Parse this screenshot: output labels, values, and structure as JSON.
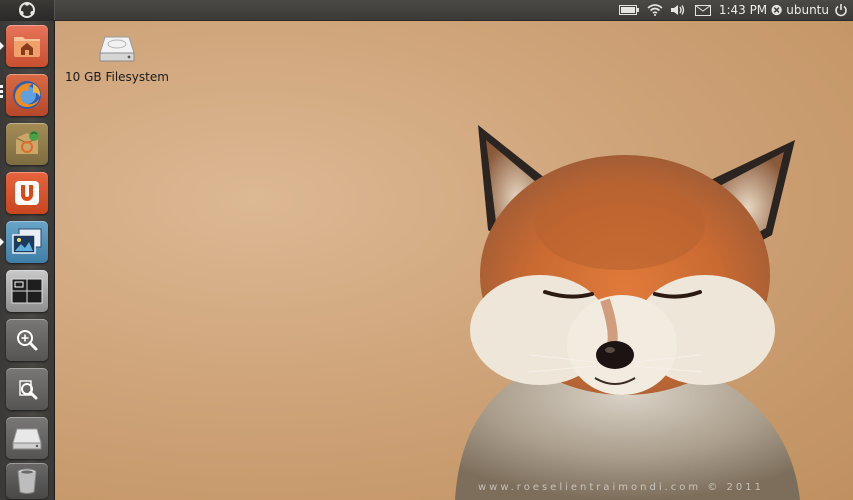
{
  "top_panel": {
    "clock": "1:43 PM",
    "username": "ubuntu",
    "indicators": {
      "battery_icon": "battery-icon",
      "network_icon": "wifi-icon",
      "sound_icon": "volume-icon",
      "messaging_icon": "mail-icon",
      "power_icon": "power-icon"
    }
  },
  "launcher": {
    "items": [
      {
        "name": "home-folder",
        "icon": "folder-home-icon"
      },
      {
        "name": "firefox",
        "icon": "firefox-icon"
      },
      {
        "name": "ubuntu-software-center",
        "icon": "software-center-icon"
      },
      {
        "name": "ubuntu-one",
        "icon": "ubuntu-one-icon",
        "glyph": "U"
      },
      {
        "name": "shotwell",
        "icon": "photo-viewer-icon"
      },
      {
        "name": "workspace-switcher",
        "icon": "workspace-switcher-icon"
      },
      {
        "name": "dash-applications",
        "icon": "zoom-in-icon"
      },
      {
        "name": "dash-files",
        "icon": "file-search-icon"
      },
      {
        "name": "filesystem",
        "icon": "drive-icon"
      },
      {
        "name": "trash",
        "icon": "trash-icon"
      }
    ]
  },
  "desktop": {
    "icons": [
      {
        "label": "10 GB Filesystem",
        "icon": "drive-icon"
      }
    ],
    "wallpaper_watermark": "www.roeselientraimondi.com © 2011"
  },
  "colors": {
    "panel": "#3c3b37",
    "launcher": "#433f3c",
    "wallpaper": "#d4aa80",
    "accent": "#dd4814"
  }
}
